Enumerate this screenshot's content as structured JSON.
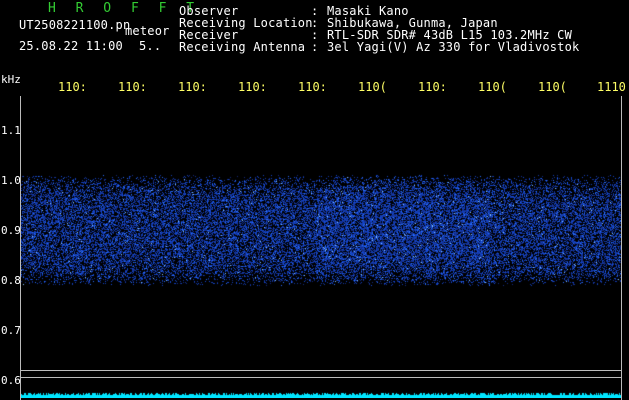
{
  "header": {
    "brand": "H R O F F T",
    "filename": "UT2508221100.pn",
    "meteor_label": "meteor",
    "datetime": "25.08.22 11:00",
    "datetime_tail": "5..",
    "rows": [
      {
        "key": "Observer",
        "value": "Masaki Kano"
      },
      {
        "key": "Receiving Location",
        "value": "Shibukawa, Gunma, Japan"
      },
      {
        "key": "Receiver",
        "value": "RTL-SDR SDR# 43dB L15 103.2MHz CW"
      },
      {
        "key": "Receiving Antenna",
        "value": "3el Yagi(V) Az 330 for Vladivostok"
      }
    ],
    "separator": ":"
  },
  "axes": {
    "y_unit": "kHz",
    "x_ticks": [
      "110:",
      "110:",
      "110:",
      "110:",
      "110:",
      "110(",
      "110:",
      "110(",
      "110(",
      "1110"
    ],
    "y_ticks": [
      "1.1",
      "1.0",
      "0.9",
      "0.8",
      "0.7",
      "0.6"
    ]
  },
  "colors": {
    "background": "#000000",
    "signal": "#2a4cff",
    "noise_floor": "#00e5ff",
    "tick_text": "#ffff66",
    "brand": "#33cc33"
  }
}
